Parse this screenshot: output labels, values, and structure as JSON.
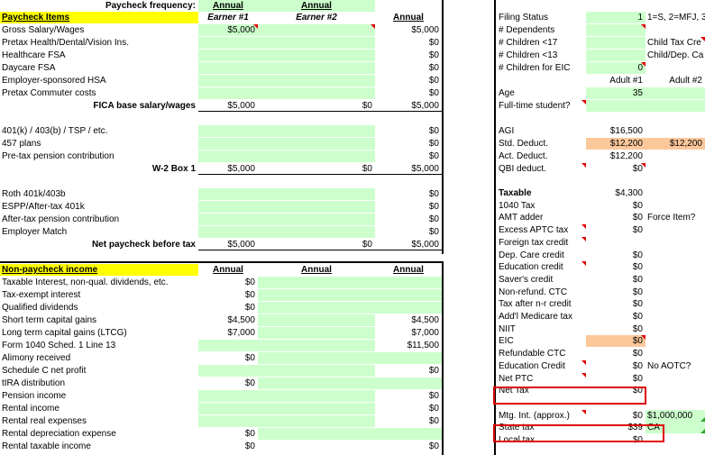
{
  "header": {
    "paycheck_frequency_label": "Paycheck frequency:",
    "freq1": "Annual",
    "freq2": "Annual",
    "section_title": "Paycheck Items",
    "earner1": "Earner #1",
    "earner2": "Earner #2",
    "annual": "Annual"
  },
  "paycheck_rows": [
    {
      "label": "Gross Salary/Wages",
      "e1": "$5,000",
      "e2": "",
      "annual": "$5,000"
    },
    {
      "label": "Pretax Health/Dental/Vision Ins.",
      "e1": "",
      "e2": "",
      "annual": "$0"
    },
    {
      "label": "Healthcare FSA",
      "e1": "",
      "e2": "",
      "annual": "$0"
    },
    {
      "label": "Daycare FSA",
      "e1": "",
      "e2": "",
      "annual": "$0"
    },
    {
      "label": "Employer-sponsored HSA",
      "e1": "",
      "e2": "",
      "annual": "$0"
    },
    {
      "label": "Pretax Commuter costs",
      "e1": "",
      "e2": "",
      "annual": "$0"
    },
    {
      "label": "FICA base salary/wages",
      "e1": "$5,000",
      "e2": "$0",
      "annual": "$5,000"
    },
    {
      "label": "",
      "e1": "",
      "e2": "",
      "annual": ""
    },
    {
      "label": "401(k) / 403(b) / TSP / etc.",
      "e1": "",
      "e2": "",
      "annual": "$0"
    },
    {
      "label": "457 plans",
      "e1": "",
      "e2": "",
      "annual": "$0"
    },
    {
      "label": "Pre-tax pension contribution",
      "e1": "",
      "e2": "",
      "annual": "$0"
    },
    {
      "label": "W-2 Box 1",
      "e1": "$5,000",
      "e2": "$0",
      "annual": "$5,000"
    },
    {
      "label": "",
      "e1": "",
      "e2": "",
      "annual": ""
    },
    {
      "label": "Roth 401k/403b",
      "e1": "",
      "e2": "",
      "annual": "$0"
    },
    {
      "label": "ESPP/After-tax 401k",
      "e1": "",
      "e2": "",
      "annual": "$0"
    },
    {
      "label": "After-tax pension contribution",
      "e1": "",
      "e2": "",
      "annual": "$0"
    },
    {
      "label": "Employer Match",
      "e1": "",
      "e2": "",
      "annual": "$0"
    },
    {
      "label": "Net paycheck before tax",
      "e1": "$5,000",
      "e2": "$0",
      "annual": "$5,000"
    }
  ],
  "nonpay_header": {
    "title": "Non-paycheck income",
    "c1": "Annual",
    "c2": "Annual",
    "c3": "Annual"
  },
  "nonpay_rows": [
    {
      "label": "Taxable Interest, non-qual. dividends, etc.",
      "a1": "$0",
      "a2": "",
      "a3": ""
    },
    {
      "label": "Tax-exempt interest",
      "a1": "$0",
      "a2": "",
      "a3": ""
    },
    {
      "label": "Qualified dividends",
      "a1": "$0",
      "a2": "",
      "a3": ""
    },
    {
      "label": "Short term capital gains",
      "a1": "$4,500",
      "a2": "",
      "a3": "$4,500"
    },
    {
      "label": "Long term capital gains (LTCG)",
      "a1": "$7,000",
      "a2": "",
      "a3": "$7,000"
    },
    {
      "label": "Form 1040 Sched. 1 Line 13",
      "a1": "",
      "a2": "",
      "a3": "$11,500"
    },
    {
      "label": "Alimony received",
      "a1": "$0",
      "a2": "",
      "a3": ""
    },
    {
      "label": "Schedule C net profit",
      "a1": "",
      "a2": "",
      "a3": "$0"
    },
    {
      "label": "tIRA distribution",
      "a1": "$0",
      "a2": "",
      "a3": ""
    },
    {
      "label": "Pension income",
      "a1": "",
      "a2": "",
      "a3": "$0"
    },
    {
      "label": "Rental income",
      "a1": "",
      "a2": "",
      "a3": "$0"
    },
    {
      "label": "Rental real expenses",
      "a1": "",
      "a2": "",
      "a3": "$0"
    },
    {
      "label": "Rental depreciation expense",
      "a1": "$0",
      "a2": "",
      "a3": ""
    },
    {
      "label": "Rental taxable income",
      "a1": "$0",
      "a2": "",
      "a3": "$0"
    }
  ],
  "filing": {
    "status_label": "Filing Status",
    "status_value": "1",
    "status_note": "1=S, 2=MFJ, 3",
    "dependents_label": "# Dependents",
    "children17_label": "# Children <17",
    "child_tax_note": "Child Tax Cre",
    "children13_label": "# Children <13",
    "child_dep_note": "Child/Dep. Ca",
    "eic_label": "# Children for EIC",
    "eic_value": "0",
    "adult1": "Adult #1",
    "adult2": "Adult #2",
    "age_label": "Age",
    "age_value": "35",
    "student_label": "Full-time student?"
  },
  "agi_rows": [
    {
      "label": "AGI",
      "v1": "$16,500",
      "v2": ""
    },
    {
      "label": "Std. Deduct.",
      "v1": "$12,200",
      "v2": "$12,200"
    },
    {
      "label": "Act. Deduct.",
      "v1": "$12,200",
      "v2": ""
    },
    {
      "label": "QBI deduct.",
      "v1": "$0",
      "v2": ""
    }
  ],
  "tax_rows": [
    {
      "label": "Taxable",
      "v": "$4,300",
      "note": ""
    },
    {
      "label": "1040 Tax",
      "v": "$0",
      "note": ""
    },
    {
      "label": "AMT adder",
      "v": "$0",
      "note": "Force Item?"
    },
    {
      "label": "Excess APTC tax",
      "v": "$0",
      "note": ""
    },
    {
      "label": "Foreign tax credit",
      "v": "",
      "note": ""
    },
    {
      "label": "Dep. Care credit",
      "v": "$0",
      "note": ""
    },
    {
      "label": "Education credit",
      "v": "$0",
      "note": ""
    },
    {
      "label": "Saver's credit",
      "v": "$0",
      "note": ""
    },
    {
      "label": "Non-refund. CTC",
      "v": "$0",
      "note": ""
    },
    {
      "label": "Tax after n-r credit",
      "v": "$0",
      "note": ""
    },
    {
      "label": "Add'l Medicare tax",
      "v": "$0",
      "note": ""
    },
    {
      "label": "NIIT",
      "v": "$0",
      "note": ""
    },
    {
      "label": "EIC",
      "v": "$0",
      "note": ""
    },
    {
      "label": "Refundable CTC",
      "v": "$0",
      "note": ""
    },
    {
      "label": "Education Credit",
      "v": "$0",
      "note": "No AOTC?"
    },
    {
      "label": "Net PTC",
      "v": "$0",
      "note": ""
    },
    {
      "label": "Net Tax",
      "v": "$0",
      "note": ""
    },
    {
      "label": "",
      "v": "",
      "note": ""
    },
    {
      "label": "Mtg. Int. (approx.)",
      "v": "$0",
      "note": "$1,000,000"
    },
    {
      "label": "State tax",
      "v": "$39",
      "note": "CA"
    },
    {
      "label": "Local tax",
      "v": "$0",
      "note": ""
    }
  ]
}
